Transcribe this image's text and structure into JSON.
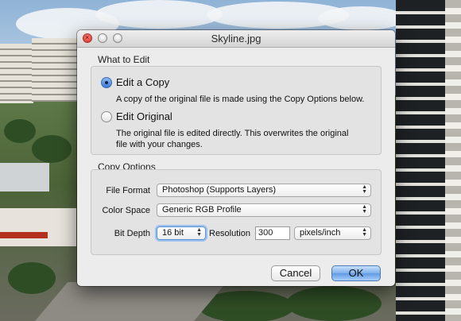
{
  "window": {
    "title": "Skyline.jpg"
  },
  "what_to_edit": {
    "heading": "What to Edit",
    "edit_copy": {
      "label": "Edit a Copy",
      "selected": true,
      "description": "A copy of the original file is made using the Copy Options below."
    },
    "edit_original": {
      "label": "Edit Original",
      "selected": false,
      "description_line1": "The original file is edited directly.  This overwrites the original",
      "description_line2": "file with your changes."
    }
  },
  "copy_options": {
    "heading": "Copy Options",
    "file_format": {
      "label": "File Format",
      "value": "Photoshop (Supports Layers)"
    },
    "color_space": {
      "label": "Color Space",
      "value": "Generic RGB Profile"
    },
    "bit_depth": {
      "label": "Bit Depth",
      "value": "16 bit"
    },
    "resolution": {
      "label": "Resolution",
      "value": "300",
      "unit": "pixels/inch"
    }
  },
  "buttons": {
    "cancel": "Cancel",
    "ok": "OK"
  },
  "icons": {
    "close": "close-icon",
    "minimize": "minimize-icon",
    "zoom": "zoom-icon",
    "popup": "popup-arrows-icon"
  },
  "colors": {
    "default_button": "#5e9be4",
    "radio_selected": "#3a7ad8"
  }
}
